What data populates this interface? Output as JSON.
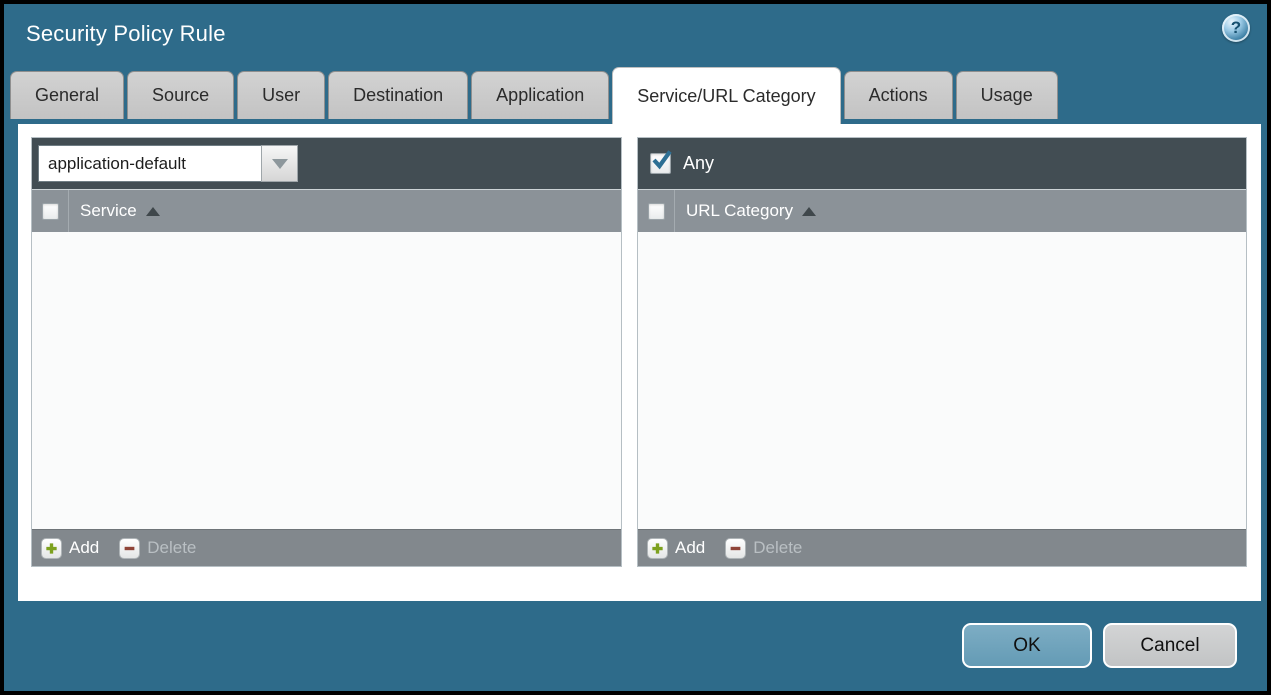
{
  "window": {
    "title": "Security Policy Rule",
    "help_icon": "?"
  },
  "tabs": [
    {
      "label": "General",
      "active": false
    },
    {
      "label": "Source",
      "active": false
    },
    {
      "label": "User",
      "active": false
    },
    {
      "label": "Destination",
      "active": false
    },
    {
      "label": "Application",
      "active": false
    },
    {
      "label": "Service/URL Category",
      "active": true
    },
    {
      "label": "Actions",
      "active": false
    },
    {
      "label": "Usage",
      "active": false
    }
  ],
  "service_panel": {
    "dropdown_value": "application-default",
    "header_checkbox_checked": false,
    "column_header": "Service",
    "sort": "ascending",
    "rows": [],
    "add_label": "Add",
    "delete_label": "Delete",
    "delete_disabled": true
  },
  "url_category_panel": {
    "any_label": "Any",
    "any_checked": true,
    "header_checkbox_checked": false,
    "column_header": "URL Category",
    "sort": "ascending",
    "rows": [],
    "add_label": "Add",
    "delete_label": "Delete",
    "delete_disabled": true
  },
  "dialog_buttons": {
    "ok": "OK",
    "cancel": "Cancel"
  },
  "colors": {
    "dialog_background": "#2e6b8a",
    "panel_toolbar": "#424d53",
    "table_header": "#8b9298",
    "table_footer": "#82888d",
    "inactive_tab": "#c8c8c8",
    "active_tab": "#ffffff",
    "ok_button": "#6ba3bd",
    "cancel_button": "#c9cbcc",
    "checkmark": "#2d6f94",
    "add_icon_green": "#7da11e",
    "delete_icon_red": "#8f4438"
  }
}
